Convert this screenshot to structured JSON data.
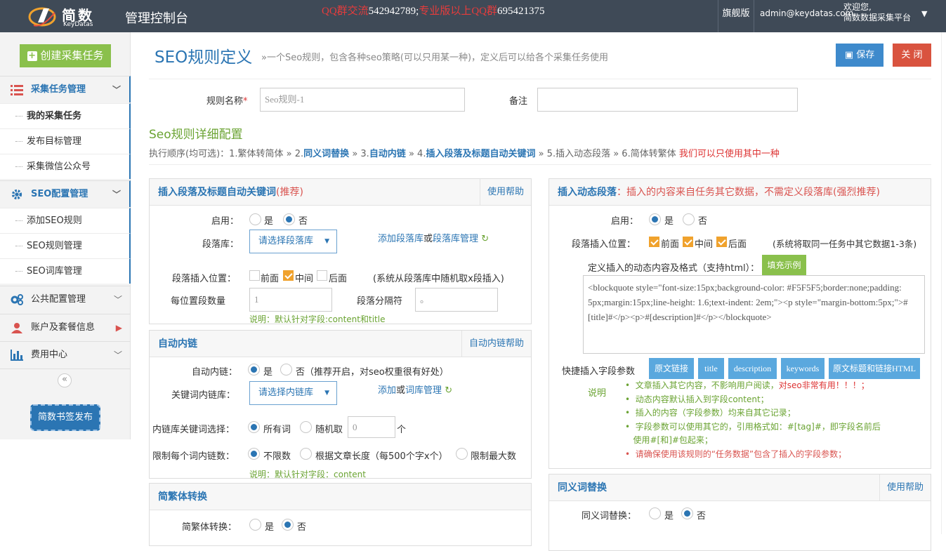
{
  "header": {
    "brand": "简数",
    "brand_sub": "KeyDatas",
    "console_title": "管理控制台",
    "qq_group_label": "QQ群交流",
    "qq_group_number": "542942789;",
    "qq_pro_label": "专业版以上QQ群",
    "qq_pro_number": "695421375",
    "edition": "旗舰版",
    "user_email": "admin@keydatas.com",
    "welcome_line1": "欢迎您,",
    "welcome_line2": "简数数据采集平台"
  },
  "sidebar": {
    "create_button": "创建采集任务",
    "menu": [
      {
        "label": "采集任务管理",
        "icon": "list-icon"
      },
      {
        "label": "SEO配置管理",
        "icon": "gear-icon"
      },
      {
        "label": "公共配置管理",
        "icon": "gears-icon"
      },
      {
        "label": "账户及套餐信息",
        "icon": "user-icon"
      },
      {
        "label": "费用中心",
        "icon": "bar-chart-icon"
      }
    ],
    "task_items": [
      "我的采集任务",
      "发布目标管理",
      "采集微信公众号"
    ],
    "seo_items": [
      "添加SEO规则",
      "SEO规则管理",
      "SEO词库管理"
    ],
    "collapse_glyph": "«",
    "tag_button": "简数书签发布"
  },
  "page": {
    "title": "SEO规则定义",
    "description": "»一个Seo规则，包含各种seo策略(可以只用某一种)，定义后可以给各个采集任务使用",
    "save_label": "保存",
    "close_label": "关 闭",
    "rule_name_label": "规则名称",
    "rule_name_value": "Seo规则-1",
    "remark_label": "备注",
    "remark_value": "",
    "detail_title": "Seo规则详细配置",
    "flow_prefix": "执行顺序(均可选)：1.繁体转简体 » 2.",
    "flow_s2": "同义词替换",
    "flow_mid1": " » 3.",
    "flow_s3": "自动内链",
    "flow_mid2": " » 4.",
    "flow_s4": "插入段落及标题自动关键词",
    "flow_tail": " » 5.插入动态段落 » 6.简体转繁体 ",
    "flow_note": "我们可以只使用其中一种"
  },
  "panel_paragraph": {
    "title": "插入段落及标题自动关键词",
    "title_note": "(推荐)",
    "help": "使用帮助",
    "enable_label": "启用：",
    "yes": "是",
    "no": "否",
    "lib_label": "段落库：",
    "lib_select": "请选择段落库",
    "lib_add": "添加段落库",
    "lib_or": "或",
    "lib_manage": "段落库管理",
    "pos_label": "段落插入位置：",
    "pos_front": "前面",
    "pos_mid": "中间",
    "pos_back": "后面",
    "pos_note": "(系统从段落库中随机取x段插入)",
    "count_label": "每位置段数量",
    "count_value": "1",
    "sep_label": "段落分隔符",
    "sep_value": "。",
    "note": "说明：默认针对字段:content和title"
  },
  "panel_link": {
    "title": "自动内链",
    "help": "自动内链帮助",
    "enable_label": "自动内链：",
    "yes": "是",
    "no": "否（推荐开启，对seo权重很有好处）",
    "lib_label": "关键词内链库：",
    "lib_select": "请选择内链库",
    "lib_add": "添加",
    "lib_or": "或",
    "lib_manage": "词库管理",
    "choose_label": "内链库关键词选择：",
    "choose_all": "所有词",
    "choose_random": "随机取",
    "random_value": "0",
    "random_unit": "个",
    "limit_label": "限制每个词内链数：",
    "limit_none": "不限数",
    "limit_by_len": "根据文章长度（每500个字x个）",
    "limit_max": "限制最大数",
    "note": "说明：默认针对字段：content"
  },
  "panel_convert": {
    "title": "简繁体转换",
    "label": "简繁体转换：",
    "yes": "是",
    "no": "否"
  },
  "panel_dynamic": {
    "title": "插入动态段落",
    "title_note": "：插入的内容来自任务其它数据，不需定义段落库(强烈推荐)",
    "enable_label": "启用：",
    "yes": "是",
    "no": "否",
    "pos_label": "段落插入位置：",
    "pos_front": "前面",
    "pos_mid": "中间",
    "pos_back": "后面",
    "pos_note": "(系统将取同一任务中其它数据1-3条)",
    "format_label": "定义插入的动态内容及格式（支持html）：",
    "fill_button": "填充示例",
    "textarea_value": "<blockquote style=\"font-size:15px;background-color: #F5F5F5;border:none;padding: 5px;margin:15px;line-height: 1.6;text-indent: 2em;\"><p style=\"margin-bottom:5px;\">#[title]#</p><p>#[description]#</p></blockquote>",
    "quick_label": "快捷插入字段参数",
    "quick_buttons": [
      "原文链接",
      "title",
      "description",
      "keywords",
      "原文标题和链接HTML"
    ],
    "note_label": "说明",
    "notes": [
      "文章插入其它内容，不影响用户阅读，",
      "对seo非常有用！！！；",
      "动态内容默认插入到字段content；",
      "插入的内容（字段参数）均来自其它记录；",
      "字段参数可以使用其它的，引用格式如：#[tag]#，即字段名前后",
      "使用#[和]#包起来；",
      "请确保使用该规则的“任务数据”包含了插入的字段参数；"
    ]
  },
  "panel_synonym": {
    "title": "同义词替换",
    "help": "使用帮助",
    "label": "同义词替换：",
    "yes": "是",
    "no": "否"
  },
  "colors": {
    "topbar": "#3f4a57",
    "accent": "#2b75b3",
    "green": "#6aa332",
    "red": "#d9534f",
    "checkbox": "#f0a22d"
  }
}
